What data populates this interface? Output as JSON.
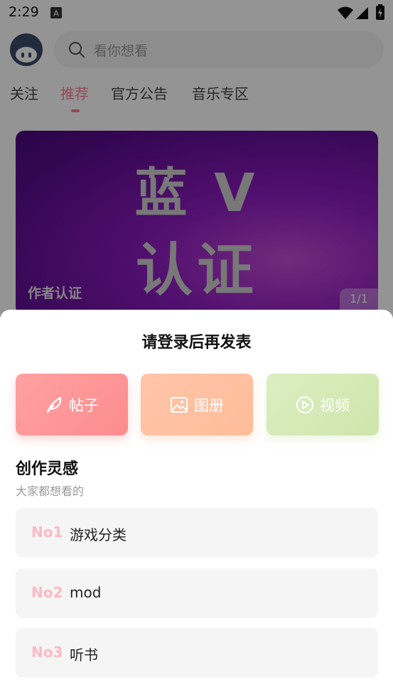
{
  "status_bar": {
    "time": "2:29"
  },
  "header": {
    "search_placeholder": "看你想看"
  },
  "tabs": [
    {
      "label": "关注"
    },
    {
      "label": "推荐",
      "active": true
    },
    {
      "label": "官方公告"
    },
    {
      "label": "音乐专区"
    }
  ],
  "banner": {
    "line1": "蓝 V",
    "line2": "认证",
    "caption": "作者认证",
    "pager": "1/1"
  },
  "sheet": {
    "title": "请登录后再发表",
    "post_types": [
      {
        "label": "帖子",
        "icon": "feather-icon"
      },
      {
        "label": "图册",
        "icon": "image-icon"
      },
      {
        "label": "视频",
        "icon": "play-circle-icon"
      }
    ],
    "inspiration": {
      "title": "创作灵感",
      "subtitle": "大家都想看的",
      "items": [
        {
          "rank": "No1",
          "text": "游戏分类"
        },
        {
          "rank": "No2",
          "text": "mod"
        },
        {
          "rank": "No3",
          "text": "听书"
        }
      ]
    }
  },
  "colors": {
    "accent": "#ff7f93",
    "post_button": "#fc8c8e",
    "album_button": "#fdbd9a",
    "video_button": "#cfe5ac",
    "rank_text": "#ffb8c4"
  }
}
